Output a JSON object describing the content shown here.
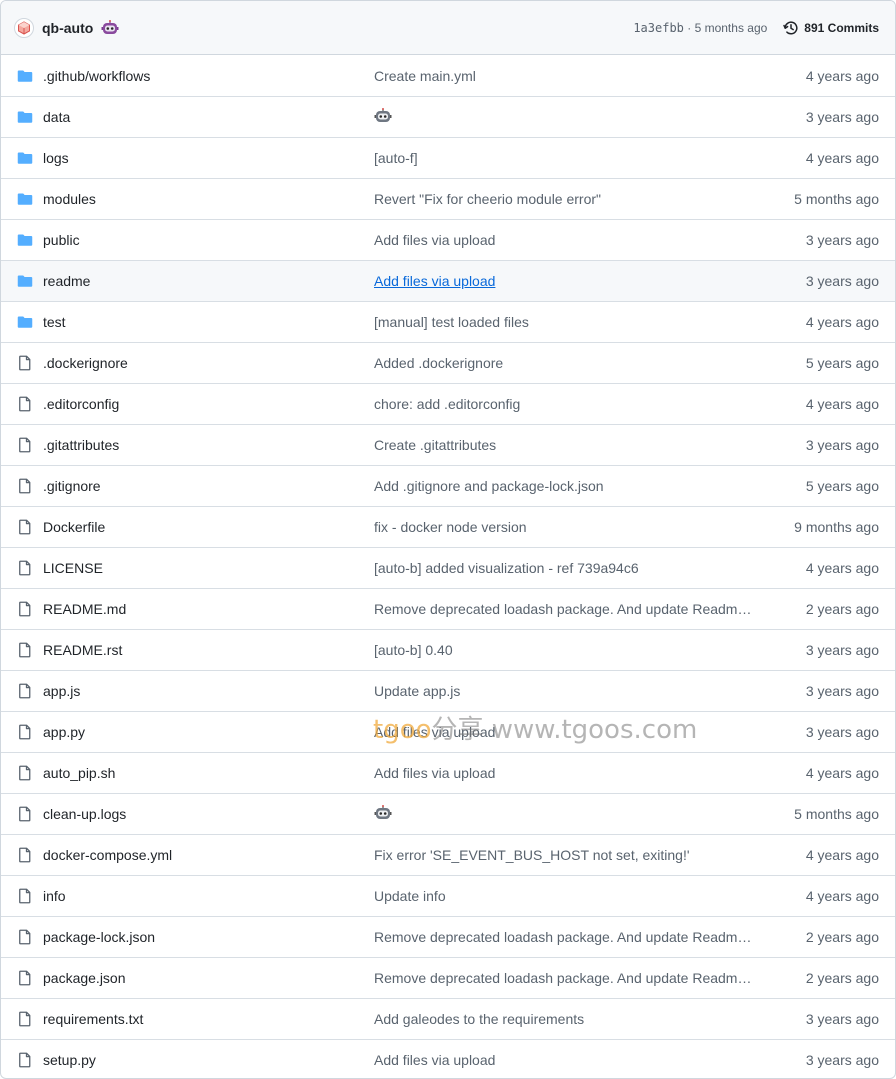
{
  "header": {
    "author": "qb-auto",
    "sha": "1a3efbb",
    "separator": " · ",
    "age": "5 months ago",
    "commits_label": "891 Commits"
  },
  "colors": {
    "folder": "#54aeff",
    "file": "#59636e",
    "link": "#0969da"
  },
  "rows": [
    {
      "type": "folder",
      "name": ".github/workflows",
      "message": "Create main.yml",
      "age": "4 years ago"
    },
    {
      "type": "folder",
      "name": "data",
      "message": "",
      "message_icon": "robot-icon",
      "age": "3 years ago"
    },
    {
      "type": "folder",
      "name": "logs",
      "message": "[auto-f]",
      "age": "4 years ago"
    },
    {
      "type": "folder",
      "name": "modules",
      "message": "Revert \"Fix for cheerio module error\"",
      "age": "5 months ago"
    },
    {
      "type": "folder",
      "name": "public",
      "message": "Add files via upload",
      "age": "3 years ago"
    },
    {
      "type": "folder",
      "name": "readme",
      "message": "Add files via upload",
      "age": "3 years ago",
      "hover": true
    },
    {
      "type": "folder",
      "name": "test",
      "message": "[manual] test loaded files",
      "age": "4 years ago"
    },
    {
      "type": "file",
      "name": ".dockerignore",
      "message": "Added .dockerignore",
      "age": "5 years ago"
    },
    {
      "type": "file",
      "name": ".editorconfig",
      "message": "chore: add .editorconfig",
      "age": "4 years ago"
    },
    {
      "type": "file",
      "name": ".gitattributes",
      "message": "Create .gitattributes",
      "age": "3 years ago"
    },
    {
      "type": "file",
      "name": ".gitignore",
      "message": "Add .gitignore and package-lock.json",
      "age": "5 years ago"
    },
    {
      "type": "file",
      "name": "Dockerfile",
      "message": "fix - docker node version",
      "age": "9 months ago"
    },
    {
      "type": "file",
      "name": "LICENSE",
      "message": "[auto-b] added visualization - ref 739a94c6",
      "age": "4 years ago"
    },
    {
      "type": "file",
      "name": "README.md",
      "message": "Remove deprecated loadash package. And update Readme....",
      "age": "2 years ago"
    },
    {
      "type": "file",
      "name": "README.rst",
      "message": "[auto-b] 0.40",
      "age": "3 years ago"
    },
    {
      "type": "file",
      "name": "app.js",
      "message": "Update app.js",
      "age": "3 years ago"
    },
    {
      "type": "file",
      "name": "app.py",
      "message": "Add files via upload",
      "age": "3 years ago"
    },
    {
      "type": "file",
      "name": "auto_pip.sh",
      "message": "Add files via upload",
      "age": "4 years ago"
    },
    {
      "type": "file",
      "name": "clean-up.logs",
      "message": "",
      "message_icon": "robot-icon",
      "age": "5 months ago"
    },
    {
      "type": "file",
      "name": "docker-compose.yml",
      "message": "Fix error 'SE_EVENT_BUS_HOST not set, exiting!'",
      "age": "4 years ago"
    },
    {
      "type": "file",
      "name": "info",
      "message": "Update info",
      "age": "4 years ago"
    },
    {
      "type": "file",
      "name": "package-lock.json",
      "message": "Remove deprecated loadash package. And update Readme....",
      "age": "2 years ago"
    },
    {
      "type": "file",
      "name": "package.json",
      "message": "Remove deprecated loadash package. And update Readme....",
      "age": "2 years ago"
    },
    {
      "type": "file",
      "name": "requirements.txt",
      "message": "Add galeodes to the requirements",
      "age": "3 years ago"
    },
    {
      "type": "file",
      "name": "setup.py",
      "message": "Add files via upload",
      "age": "3 years ago"
    }
  ],
  "watermark": {
    "part1": "tgoo",
    "part2": "分享 www.tgoos.com"
  }
}
